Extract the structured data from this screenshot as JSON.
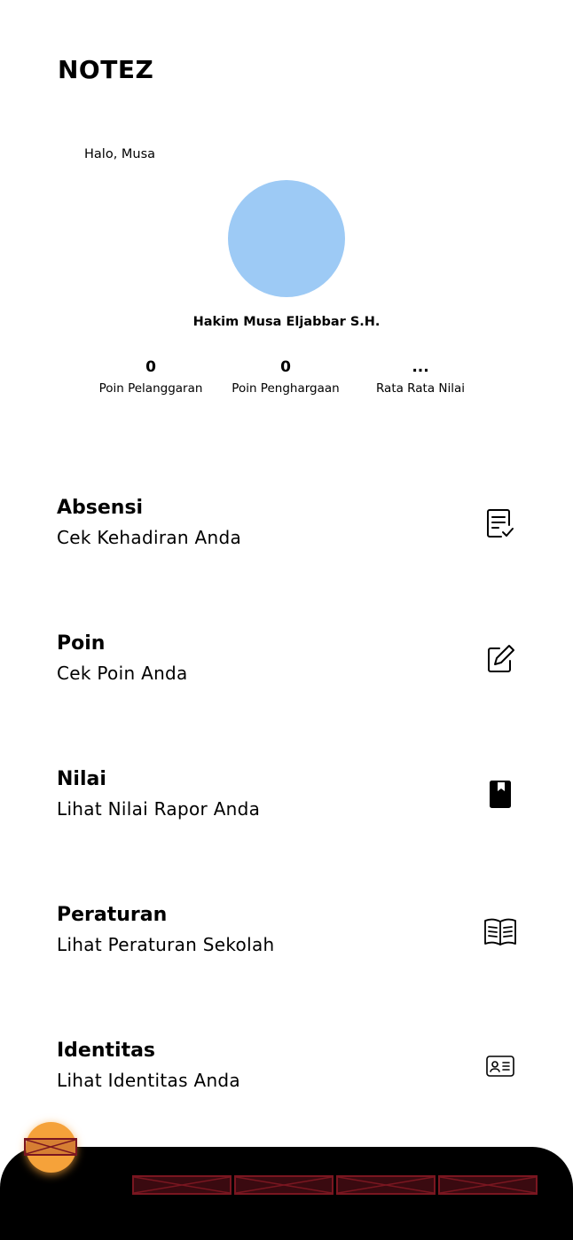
{
  "app": {
    "title": "NOTEZ"
  },
  "profile": {
    "greeting": "Halo, Musa",
    "name": "Hakim Musa Eljabbar S.H.",
    "avatar_color": "#9dcaf5"
  },
  "stats": [
    {
      "value": "0",
      "label": "Poin Pelanggaran"
    },
    {
      "value": "0",
      "label": "Poin Penghargaan"
    },
    {
      "value": "...",
      "label": "Rata Rata Nilai"
    }
  ],
  "menu": [
    {
      "title": "Absensi",
      "subtitle": "Cek Kehadiran Anda",
      "icon": "checklist-icon"
    },
    {
      "title": "Poin",
      "subtitle": "Cek Poin Anda",
      "icon": "edit-icon"
    },
    {
      "title": "Nilai",
      "subtitle": "Lihat Nilai Rapor Anda",
      "icon": "book-icon"
    },
    {
      "title": "Peraturan",
      "subtitle": "Lihat Peraturan Sekolah",
      "icon": "open-book-icon"
    },
    {
      "title": "Identitas",
      "subtitle": "Lihat Identitas Anda",
      "icon": "id-card-icon"
    }
  ],
  "colors": {
    "fab": "#f5a23a",
    "bottom_bar": "#000000",
    "broken_image_placeholder": "#7a1620"
  }
}
